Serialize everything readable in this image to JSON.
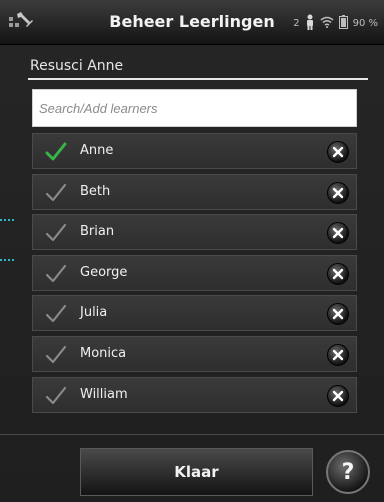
{
  "header": {
    "title": "Beheer Leerlingen",
    "status": {
      "counter": "2",
      "battery": "90 %"
    },
    "icons": [
      "tools-icon",
      "person-icon",
      "wifi-icon",
      "battery-icon"
    ]
  },
  "manikin": {
    "name": "Resusci Anne"
  },
  "search": {
    "placeholder": "Search/Add learners",
    "value": ""
  },
  "learners": [
    {
      "name": "Anne",
      "selected": true
    },
    {
      "name": "Beth",
      "selected": false
    },
    {
      "name": "Brian",
      "selected": false
    },
    {
      "name": "George",
      "selected": false
    },
    {
      "name": "Julia",
      "selected": false
    },
    {
      "name": "Monica",
      "selected": false
    },
    {
      "name": "William",
      "selected": false
    }
  ],
  "footer": {
    "done_label": "Klaar",
    "help_label": "?"
  },
  "colors": {
    "check_selected": "#37b34a",
    "check_unselected": "#8a8a8a",
    "connector": "#2fb8c4"
  }
}
